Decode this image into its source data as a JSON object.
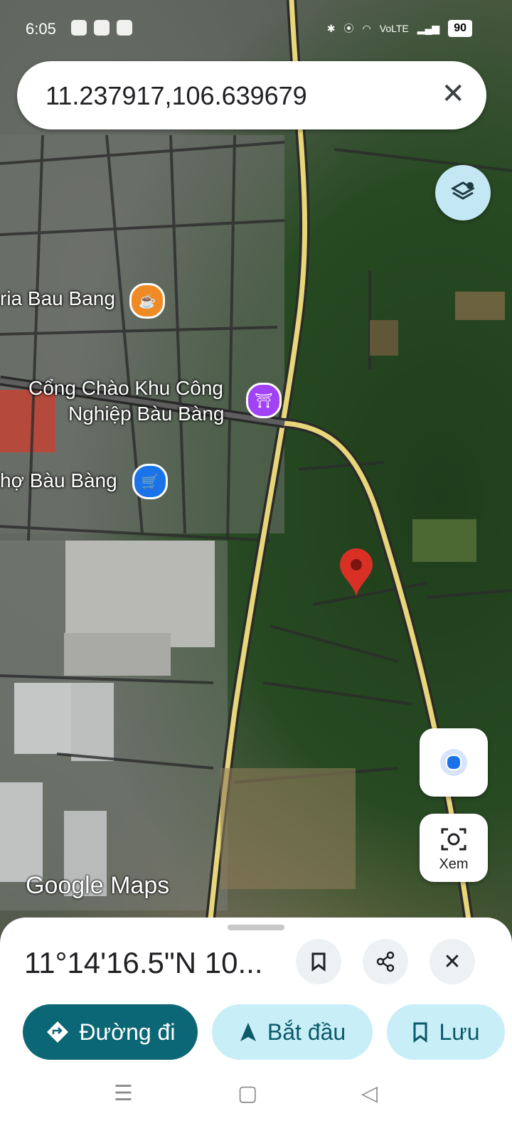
{
  "status_bar": {
    "time": "6:05",
    "battery": "90",
    "network": "VoLTE"
  },
  "search": {
    "query": "11.237917,106.639679"
  },
  "map_labels": {
    "cafe": "ria Bau Bang",
    "gate": "Cổng Chào Khu Công",
    "gate_line2": "Nghiệp Bàu Bàng",
    "market": "hợ Bàu Bàng"
  },
  "buttons": {
    "view": "Xem"
  },
  "watermark": "Google Maps",
  "sheet": {
    "title": "11°14'16.5\"N 10...",
    "directions": "Đường đi",
    "start": "Bắt đầu",
    "save": "Lưu"
  },
  "colors": {
    "accent": "#0b6776",
    "pin": "#d93025",
    "cafe": "#f08a24",
    "gate": "#a142f4",
    "market": "#1a73e8"
  }
}
